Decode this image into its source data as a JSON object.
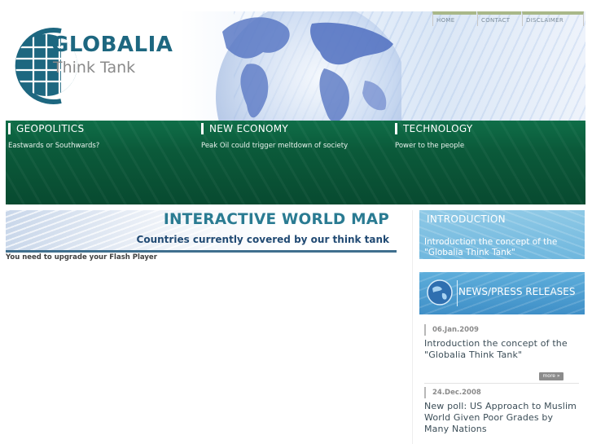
{
  "logo": {
    "title": "GLOBALIA",
    "subtitle": "Think Tank"
  },
  "topnav": {
    "items": [
      "HOME",
      "CONTACT",
      "DISCLAIMER"
    ]
  },
  "band": {
    "columns": [
      {
        "heading": "GEOPOLITICS",
        "subtext": "Eastwards or Southwards?"
      },
      {
        "heading": "NEW ECONOMY",
        "subtext": "Peak Oil could trigger meltdown of society"
      },
      {
        "heading": "TECHNOLOGY",
        "subtext": "Power to the people"
      }
    ]
  },
  "map": {
    "title": "INTERACTIVE WORLD MAP",
    "subtitle": "Countries currently covered by our think tank",
    "flash_message": "You need to upgrade your Flash Player"
  },
  "sidebar": {
    "intro": {
      "heading": "INTRODUCTION",
      "text": "Introduction the concept of the \"Globalia Think Tank\""
    },
    "news": {
      "heading": "NEWS/PRESS RELEASES",
      "items": [
        {
          "date": "06.Jan.2009",
          "title": "Introduction the concept of the \"Globalia Think Tank\""
        },
        {
          "date": "24.Dec.2008",
          "title": "New poll: US Approach to Muslim World Given Poor Grades by Many Nations"
        }
      ],
      "more_label": "more »"
    }
  },
  "colors": {
    "brand_teal": "#1d6780",
    "band_green": "#0b5a3a",
    "sidebar_blue": "#6fb7de",
    "nav_accent": "#a9b889"
  }
}
